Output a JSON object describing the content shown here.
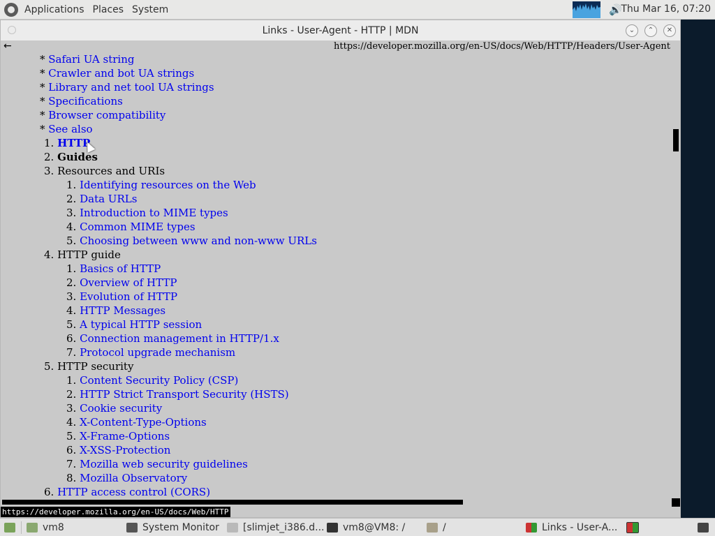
{
  "top_panel": {
    "menus": [
      "Applications",
      "Places",
      "System"
    ],
    "clock": "Thu Mar 16, 07:20"
  },
  "window": {
    "title": "Links - User-Agent - HTTP | MDN",
    "back_glyph": "←",
    "url": "https://developer.mozilla.org/en-US/docs/Web/HTTP/Headers/User-Agent",
    "status_url": "https://developer.mozilla.org/en-US/docs/Web/HTTP"
  },
  "content": {
    "toc_bullets": [
      "Safari UA string",
      "Crawler and bot UA strings",
      "Library and net tool UA strings",
      "Specifications",
      "Browser compatibility",
      "See also"
    ],
    "nav": [
      {
        "num": "1.",
        "label": "HTTP"
      },
      {
        "num": "2.",
        "label": "Guides"
      },
      {
        "num": "3.",
        "label": "Resources and URIs"
      },
      {
        "num": "1.",
        "label": "Identifying resources on the Web"
      },
      {
        "num": "2.",
        "label": "Data URLs"
      },
      {
        "num": "3.",
        "label": "Introduction to MIME types"
      },
      {
        "num": "4.",
        "label": "Common MIME types"
      },
      {
        "num": "5.",
        "label": "Choosing between www and non-www URLs"
      },
      {
        "num": "4.",
        "label": "HTTP guide"
      },
      {
        "num": "1.",
        "label": "Basics of HTTP"
      },
      {
        "num": "2.",
        "label": "Overview of HTTP"
      },
      {
        "num": "3.",
        "label": "Evolution of HTTP"
      },
      {
        "num": "4.",
        "label": "HTTP Messages"
      },
      {
        "num": "5.",
        "label": "A typical HTTP session"
      },
      {
        "num": "6.",
        "label": "Connection management in HTTP/1.x"
      },
      {
        "num": "7.",
        "label": "Protocol upgrade mechanism"
      },
      {
        "num": "5.",
        "label": "HTTP security"
      },
      {
        "num": "1.",
        "label": "Content Security Policy (CSP)"
      },
      {
        "num": "2.",
        "label": "HTTP Strict Transport Security (HSTS)"
      },
      {
        "num": "3.",
        "label": "Cookie security"
      },
      {
        "num": "4.",
        "label": "X-Content-Type-Options"
      },
      {
        "num": "5.",
        "label": "X-Frame-Options"
      },
      {
        "num": "6.",
        "label": "X-XSS-Protection"
      },
      {
        "num": "7.",
        "label": "Mozilla web security guidelines"
      },
      {
        "num": "8.",
        "label": "Mozilla Observatory"
      },
      {
        "num": "6.",
        "label": "HTTP access control (CORS)"
      }
    ]
  },
  "taskbar": {
    "items": [
      "vm8",
      "System Monitor",
      "[slimjet_i386.d...",
      "vm8@VM8: /",
      "/",
      "Links - User-A..."
    ]
  },
  "colors": {
    "link": "#0000ee",
    "page_bg": "#c9c9c9",
    "status_bg": "#000000"
  }
}
